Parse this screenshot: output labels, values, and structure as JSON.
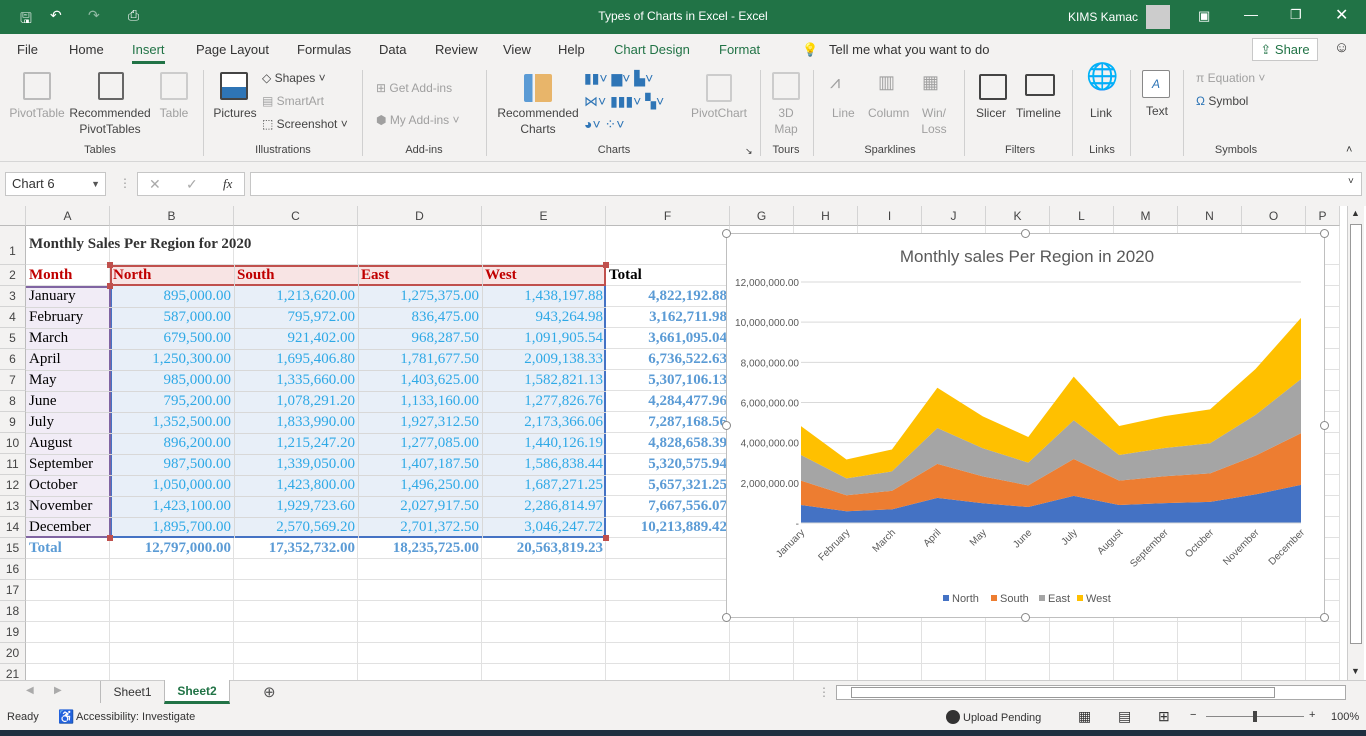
{
  "window": {
    "title": "Types of Charts in Excel  -  Excel",
    "user": "KIMS Kamac"
  },
  "menu": {
    "tabs": [
      "File",
      "Home",
      "Insert",
      "Page Layout",
      "Formulas",
      "Data",
      "Review",
      "View",
      "Help",
      "Chart Design",
      "Format"
    ],
    "active": "Insert",
    "tell_me": "Tell me what you want to do",
    "share": "Share"
  },
  "ribbon": {
    "tables": {
      "pivot": "PivotTable",
      "rec_pivot": "Recommended PivotTables",
      "table": "Table",
      "group": "Tables"
    },
    "illustrations": {
      "pictures": "Pictures",
      "shapes": "Shapes",
      "smartart": "SmartArt",
      "screenshot": "Screenshot",
      "group": "Illustrations"
    },
    "addins": {
      "get": "Get Add-ins",
      "my": "My Add-ins",
      "group": "Add-ins"
    },
    "charts": {
      "rec": "Recommended Charts",
      "pivotchart": "PivotChart",
      "group": "Charts"
    },
    "tours": {
      "map": "3D Map",
      "group": "Tours"
    },
    "sparklines": {
      "line": "Line",
      "column": "Column",
      "winloss": "Win/ Loss",
      "group": "Sparklines"
    },
    "filters": {
      "slicer": "Slicer",
      "timeline": "Timeline",
      "group": "Filters"
    },
    "links": {
      "link": "Link",
      "group": "Links"
    },
    "text": {
      "text": "Text"
    },
    "symbols": {
      "equation": "Equation",
      "symbol": "Symbol",
      "group": "Symbols"
    }
  },
  "formula_bar": {
    "name_box": "Chart 6",
    "fx": "fx",
    "value": ""
  },
  "columns": [
    "A",
    "B",
    "C",
    "D",
    "E",
    "F",
    "G",
    "H",
    "I",
    "J",
    "K",
    "L",
    "M",
    "N",
    "O",
    "P"
  ],
  "sheet": {
    "title": "Monthly Sales Per Region for 2020",
    "headers": [
      "Month",
      "North",
      "South",
      "East",
      "West",
      "Total"
    ],
    "rows": [
      [
        "January",
        "895,000.00",
        "1,213,620.00",
        "1,275,375.00",
        "1,438,197.88",
        "4,822,192.88"
      ],
      [
        "February",
        "587,000.00",
        "795,972.00",
        "836,475.00",
        "943,264.98",
        "3,162,711.98"
      ],
      [
        "March",
        "679,500.00",
        "921,402.00",
        "968,287.50",
        "1,091,905.54",
        "3,661,095.04"
      ],
      [
        "April",
        "1,250,300.00",
        "1,695,406.80",
        "1,781,677.50",
        "2,009,138.33",
        "6,736,522.63"
      ],
      [
        "May",
        "985,000.00",
        "1,335,660.00",
        "1,403,625.00",
        "1,582,821.13",
        "5,307,106.13"
      ],
      [
        "June",
        "795,200.00",
        "1,078,291.20",
        "1,133,160.00",
        "1,277,826.76",
        "4,284,477.96"
      ],
      [
        "July",
        "1,352,500.00",
        "1,833,990.00",
        "1,927,312.50",
        "2,173,366.06",
        "7,287,168.56"
      ],
      [
        "August",
        "896,200.00",
        "1,215,247.20",
        "1,277,085.00",
        "1,440,126.19",
        "4,828,658.39"
      ],
      [
        "September",
        "987,500.00",
        "1,339,050.00",
        "1,407,187.50",
        "1,586,838.44",
        "5,320,575.94"
      ],
      [
        "October",
        "1,050,000.00",
        "1,423,800.00",
        "1,496,250.00",
        "1,687,271.25",
        "5,657,321.25"
      ],
      [
        "November",
        "1,423,100.00",
        "1,929,723.60",
        "2,027,917.50",
        "2,286,814.97",
        "7,667,556.07"
      ],
      [
        "December",
        "1,895,700.00",
        "2,570,569.20",
        "2,701,372.50",
        "3,046,247.72",
        "10,213,889.42"
      ]
    ],
    "totals": [
      "Total",
      "12,797,000.00",
      "17,352,732.00",
      "18,235,725.00",
      "20,563,819.23"
    ]
  },
  "chart_data": {
    "type": "area",
    "stacked": true,
    "title": "Monthly sales Per Region in 2020",
    "categories": [
      "January",
      "February",
      "March",
      "April",
      "May",
      "June",
      "July",
      "August",
      "September",
      "October",
      "November",
      "December"
    ],
    "series": [
      {
        "name": "North",
        "color": "#4472c4",
        "values": [
          895000,
          587000,
          679500,
          1250300,
          985000,
          795200,
          1352500,
          896200,
          987500,
          1050000,
          1423100,
          1895700
        ]
      },
      {
        "name": "South",
        "color": "#ed7d31",
        "values": [
          1213620,
          795972,
          921402,
          1695406.8,
          1335660,
          1078291.2,
          1833990,
          1215247.2,
          1339050,
          1423800,
          1929723.6,
          2570569.2
        ]
      },
      {
        "name": "East",
        "color": "#a5a5a5",
        "values": [
          1275375,
          836475,
          968287.5,
          1781677.5,
          1403625,
          1133160,
          1927312.5,
          1277085,
          1407187.5,
          1496250,
          2027917.5,
          2701372.5
        ]
      },
      {
        "name": "West",
        "color": "#ffc000",
        "values": [
          1438197.88,
          943264.98,
          1091905.54,
          2009138.33,
          1582821.13,
          1277826.76,
          2173366.06,
          1440126.19,
          1586838.44,
          1687271.25,
          2286814.97,
          3046247.72
        ]
      }
    ],
    "ylim": [
      0,
      12000000
    ],
    "yticks": [
      "-",
      "2,000,000.00",
      "4,000,000.00",
      "6,000,000.00",
      "8,000,000.00",
      "10,000,000.00",
      "12,000,000.00"
    ],
    "legend": "bottom",
    "grid": true
  },
  "sheet_tabs": [
    "Sheet1",
    "Sheet2"
  ],
  "active_sheet": "Sheet2",
  "status": {
    "ready": "Ready",
    "accessibility": "Accessibility: Investigate",
    "upload": "Upload Pending",
    "zoom": "100%"
  }
}
